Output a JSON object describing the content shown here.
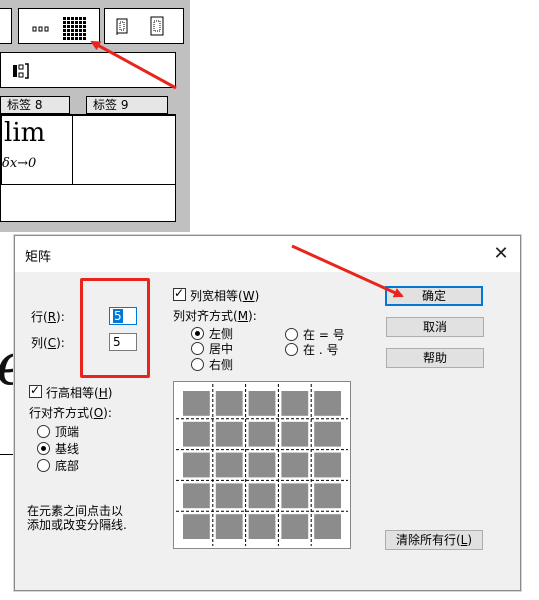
{
  "background": {
    "tabs": [
      {
        "label": "标签 8"
      },
      {
        "label": "标签 9"
      }
    ],
    "template_lim": "lim",
    "template_lim_sub": "δx→0",
    "doc_glyph": "e"
  },
  "dialog": {
    "title": "矩阵",
    "close_glyph": "✕",
    "rows_label": "行(",
    "rows_key": "R",
    "rows_tail": "):",
    "rows_value": "5",
    "cols_label": "列(",
    "cols_key": "C",
    "cols_tail": "):",
    "cols_value": "5",
    "col_equal_label": "列宽相等(",
    "col_equal_key": "W",
    "col_equal_tail": ")",
    "col_align_label": "列对齐方式(",
    "col_align_key": "M",
    "col_align_tail": "):",
    "col_align_options": [
      {
        "label": "左侧",
        "selected": true
      },
      {
        "label": "居中",
        "selected": false
      },
      {
        "label": "右侧",
        "selected": false
      },
      {
        "label": "在 = 号",
        "selected": false
      },
      {
        "label": "在 . 号",
        "selected": false
      }
    ],
    "row_equal_label": "行高相等(",
    "row_equal_key": "H",
    "row_equal_tail": ")",
    "row_align_label": "行对齐方式(",
    "row_align_key": "O",
    "row_align_tail": "):",
    "row_align_options": [
      {
        "label": "顶端",
        "selected": false
      },
      {
        "label": "基线",
        "selected": true
      },
      {
        "label": "底部",
        "selected": false
      }
    ],
    "hint_line1": "在元素之间点击以",
    "hint_line2": "添加或改变分隔线.",
    "ok_label": "确定",
    "cancel_label": "取消",
    "help_label": "帮助",
    "clear_rows_label": "清除所有行(",
    "clear_rows_key": "L",
    "clear_rows_tail": ")",
    "matrix_rows": 5,
    "matrix_cols": 5
  },
  "colors": {
    "annotation_red": "#e8241c",
    "accent_blue": "#0078d7",
    "dialog_bg": "#f0f0f0"
  }
}
